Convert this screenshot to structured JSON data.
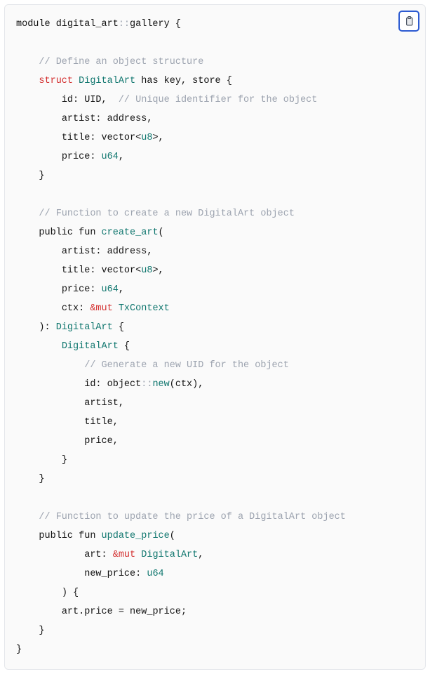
{
  "code": {
    "l1_a": "module digital_art",
    "l1_b": "::",
    "l1_c": "gallery {",
    "l3_cm": "// Define an object structure",
    "l4_kw": "struct",
    "l4_ty": " DigitalArt",
    "l4_rest": " has key, store {",
    "l5_a": "id",
    "l5_b": ": UID,  ",
    "l5_cm": "// Unique identifier for the object",
    "l6_a": "artist",
    "l6_b": ": address,",
    "l7_a": "title",
    "l7_b": ": vector<",
    "l7_ty": "u8",
    "l7_c": ">,",
    "l8_a": "price",
    "l8_b": ": ",
    "l8_ty": "u64",
    "l8_c": ",",
    "l9": "}",
    "l11_cm": "// Function to create a new DigitalArt object",
    "l12_a": "public fun ",
    "l12_ty": "create_art",
    "l12_b": "(",
    "l13_a": "artist",
    "l13_b": ": address,",
    "l14_a": "title",
    "l14_b": ": vector<",
    "l14_ty": "u8",
    "l14_c": ">,",
    "l15_a": "price",
    "l15_b": ": ",
    "l15_ty": "u64",
    "l15_c": ",",
    "l16_a": "ctx",
    "l16_b": ": ",
    "l16_kw": "&mut",
    "l16_ty": " TxContext",
    "l17_a": "): ",
    "l17_ty": "DigitalArt",
    "l17_b": " {",
    "l18_ty": "DigitalArt",
    "l18_b": " {",
    "l19_cm": "// Generate a new UID for the object",
    "l20_a": "id",
    "l20_b": ": object",
    "l20_c": "::",
    "l20_ty": "new",
    "l20_d": "(ctx),",
    "l21": "artist,",
    "l22": "title,",
    "l23": "price,",
    "l24": "}",
    "l25": "}",
    "l27_cm": "// Function to update the price of a DigitalArt object",
    "l28_a": "public fun ",
    "l28_ty": "update_price",
    "l28_b": "(",
    "l29_a": "art",
    "l29_b": ": ",
    "l29_kw": "&mut",
    "l29_ty": " DigitalArt",
    "l29_c": ",",
    "l30_a": "new_price",
    "l30_b": ": ",
    "l30_ty": "u64",
    "l31": ") {",
    "l32_a": "art",
    "l32_b": ".",
    "l32_c": "price ",
    "l32_d": "=",
    "l32_e": " new_price;",
    "l33": "}",
    "l34": "}"
  },
  "icon": "clipboard-icon"
}
